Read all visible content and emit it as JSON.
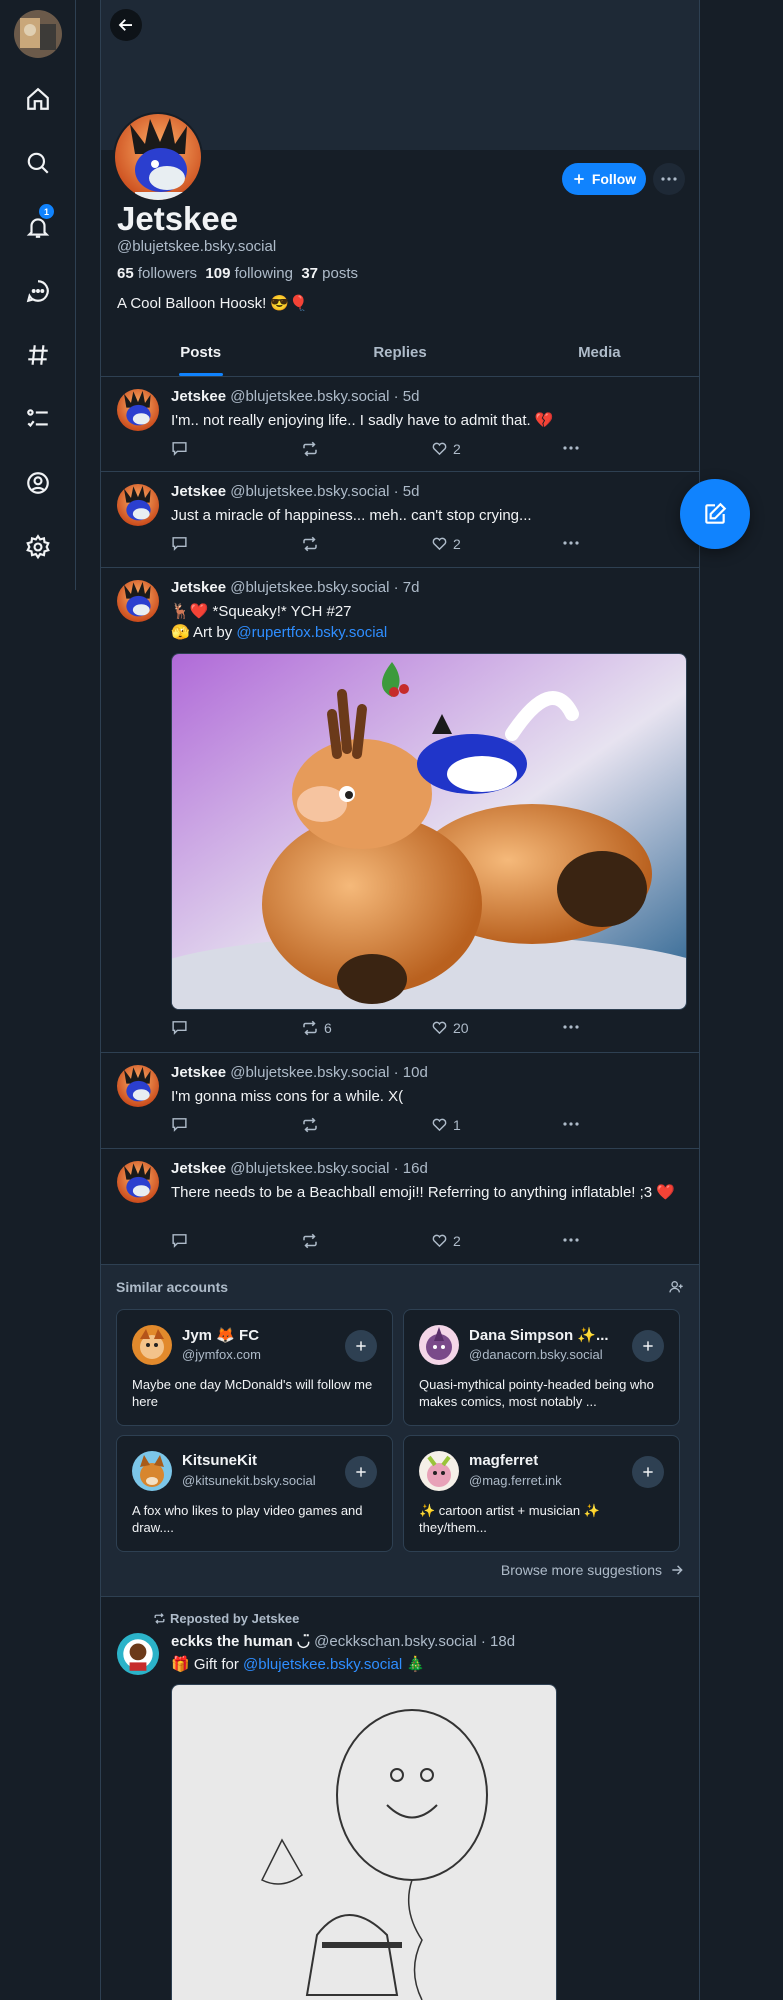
{
  "nav": {
    "notification_count": "1",
    "items": [
      "home-icon",
      "search-icon",
      "bell-icon",
      "chat-icon",
      "hashtag-icon",
      "list-icon",
      "profile-icon",
      "gear-icon"
    ]
  },
  "profile": {
    "name": "Jetskee",
    "handle": "@blujetskee.bsky.social",
    "followers_count": "65",
    "followers_label": "followers",
    "following_count": "109",
    "following_label": "following",
    "posts_count": "37",
    "posts_label": "posts",
    "bio": "A Cool Balloon Hoosk! 😎🎈",
    "follow_label": "Follow"
  },
  "tabs": [
    {
      "label": "Posts"
    },
    {
      "label": "Replies"
    },
    {
      "label": "Media"
    }
  ],
  "posts": [
    {
      "author": "Jetskee",
      "handle": "@blujetskee.bsky.social",
      "time": "· 5d",
      "text": "I'm.. not really enjoying life.. I sadly have to admit that. 💔",
      "reposts": "",
      "likes": "2"
    },
    {
      "author": "Jetskee",
      "handle": "@blujetskee.bsky.social",
      "time": "· 5d",
      "text": "Just a miracle of happiness... meh.. can't stop crying...",
      "reposts": "",
      "likes": "2"
    },
    {
      "author": "Jetskee",
      "handle": "@blujetskee.bsky.social",
      "time": "· 7d",
      "text_line1": "🦌❤️ *Squeaky!* YCH #27",
      "text_prefix": "🫣 Art by ",
      "mention": "@rupertfox.bsky.social",
      "reposts": "6",
      "likes": "20"
    },
    {
      "author": "Jetskee",
      "handle": "@blujetskee.bsky.social",
      "time": "· 10d",
      "text": "I'm gonna miss cons for a while. X(",
      "reposts": "",
      "likes": "1"
    },
    {
      "author": "Jetskee",
      "handle": "@blujetskee.bsky.social",
      "time": "· 16d",
      "text": "There needs to be a Beachball emoji!! Referring to anything inflatable! ;3 ❤️",
      "reposts": "",
      "likes": "2"
    }
  ],
  "similar": {
    "title": "Similar accounts",
    "browse_label": "Browse more suggestions",
    "accounts": [
      {
        "name": "Jym 🦊 FC",
        "handle": "@jymfox.com",
        "desc": "Maybe one day McDonald's will follow me here"
      },
      {
        "name": "Dana Simpson ✨...",
        "handle": "@danacorn.bsky.social",
        "desc": "Quasi-mythical pointy-headed being who makes comics, most notably ..."
      },
      {
        "name": "KitsuneKit",
        "handle": "@kitsunekit.bsky.social",
        "desc": "A fox who likes to play video games and draw...."
      },
      {
        "name": "magferret",
        "handle": "@mag.ferret.ink",
        "desc": "✨ cartoon artist + musician ✨ they/them..."
      }
    ]
  },
  "repost": {
    "label": "Reposted by Jetskee",
    "author": "eckks the human ◡̈",
    "handle": "@eckkschan.bsky.social",
    "time": "· 18d",
    "text_prefix": "🎁 Gift for ",
    "mention": "@blujetskee.bsky.social",
    "text_suffix": " 🎄"
  },
  "colors": {
    "accent": "#1083fe",
    "background": "#161e27",
    "muted": "#aebbc9",
    "border": "#2e4052"
  }
}
